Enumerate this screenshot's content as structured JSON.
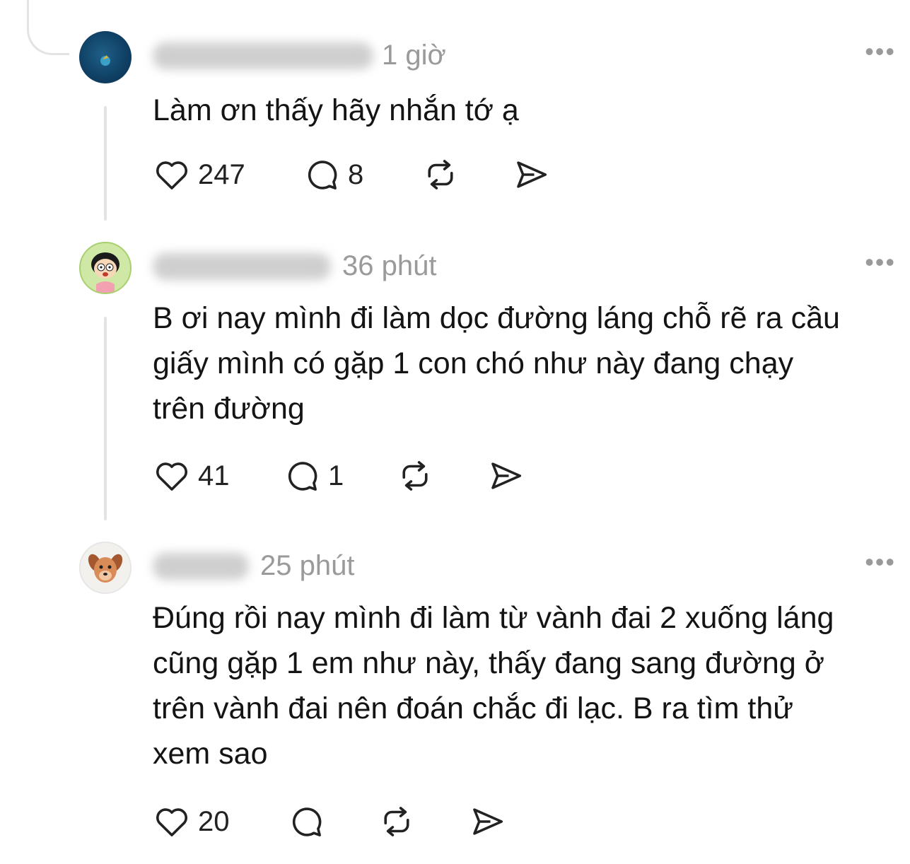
{
  "comments": [
    {
      "time": "1 giờ",
      "more": "•••",
      "text": "Làm ơn thấy hãy nhắn tớ ạ",
      "likes": "247",
      "replies": "8"
    },
    {
      "time": "36 phút",
      "more": "•••",
      "text": "B ơi nay mình đi làm dọc đường láng chỗ rẽ ra cầu\ngiấy mình có gặp 1 con chó như này đang chạy\ntrên đường",
      "likes": "41",
      "replies": "1"
    },
    {
      "time": "25 phút",
      "more": "•••",
      "text": "Đúng rồi nay mình đi làm từ vành đai 2 xuống láng\ncũng gặp 1 em như này, thấy đang sang đường ở\ntrên vành đai nên đoán chắc đi lạc. B ra tìm thử\nxem sao",
      "likes": "20",
      "replies": ""
    }
  ],
  "icons": {
    "like": "heart-icon",
    "reply": "speech-bubble-icon",
    "repost": "repost-icon",
    "share": "send-icon"
  }
}
